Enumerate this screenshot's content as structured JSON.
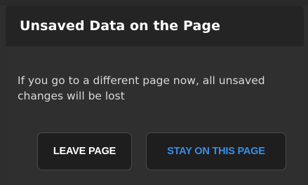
{
  "dialog": {
    "title": "Unsaved Data on the Page",
    "message": "If you go to a different page now, all unsaved changes will be lost",
    "buttons": {
      "leave_label": "LEAVE PAGE",
      "stay_label": "STAY ON THIS PAGE"
    },
    "colors": {
      "background": "#2e2e2e",
      "header_background": "#242424",
      "primary_text": "#ffffff",
      "accent": "#3a8ee6"
    }
  }
}
